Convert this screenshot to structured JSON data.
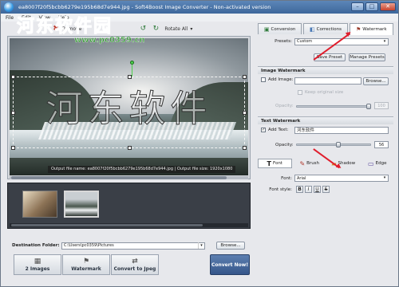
{
  "window": {
    "title": "ea8007f20f5bcbb6279e195b68d7e944.jpg - Soft4Boost Image Converter - Non-activated version",
    "min": "–",
    "max": "□",
    "close": "✕"
  },
  "menu": [
    "File",
    "Edit",
    "View",
    "Help"
  ],
  "toolbar": {
    "remove": "Remove",
    "rotate_all": "Rotate All"
  },
  "preview": {
    "watermark_text": "河东软件",
    "info": "Output file name: ea8007f20f5bcbb6279e195b68d7e944.jpg | Output file size: 1920x1080"
  },
  "overlay": {
    "logo": "河东软件园",
    "url": "www.pc0359.cn"
  },
  "destination": {
    "label": "Destination Folder:",
    "value": "C:\\Users\\pc0359\\Pictures",
    "browse": "Browse..."
  },
  "steps": [
    "2 Images",
    "Watermark",
    "Convert to Jpeg"
  ],
  "convert_now": "Convert Now!",
  "tabs": {
    "conversion": "Conversion",
    "corrections": "Corrections",
    "watermark": "Watermark"
  },
  "presets": {
    "label": "Presets:",
    "value": "Custom",
    "save": "Save Preset",
    "manage": "Manage Presets"
  },
  "image_watermark": {
    "header": "Image Watermark",
    "add_image": "Add Image:",
    "browse": "Browse...",
    "keep_size": "Keep original size",
    "opacity_label": "Opacity:",
    "opacity_value": "100"
  },
  "text_watermark": {
    "header": "Text Watermark",
    "add_text": "Add Text:",
    "text_value": "河东软件",
    "opacity_label": "Opacity:",
    "opacity_value": "56",
    "opacity_level": 0.56
  },
  "font_tabs": [
    "Font",
    "Brush",
    "Shadow",
    "Edge"
  ],
  "font": {
    "label": "Font:",
    "value": "Arial",
    "style_label": "Font style:",
    "bold": "B",
    "italic": "I",
    "underline": "U",
    "strike": "S"
  },
  "colors": {
    "accent": "#35568a",
    "arrow": "#e01e2d",
    "title": "#3d679b"
  }
}
